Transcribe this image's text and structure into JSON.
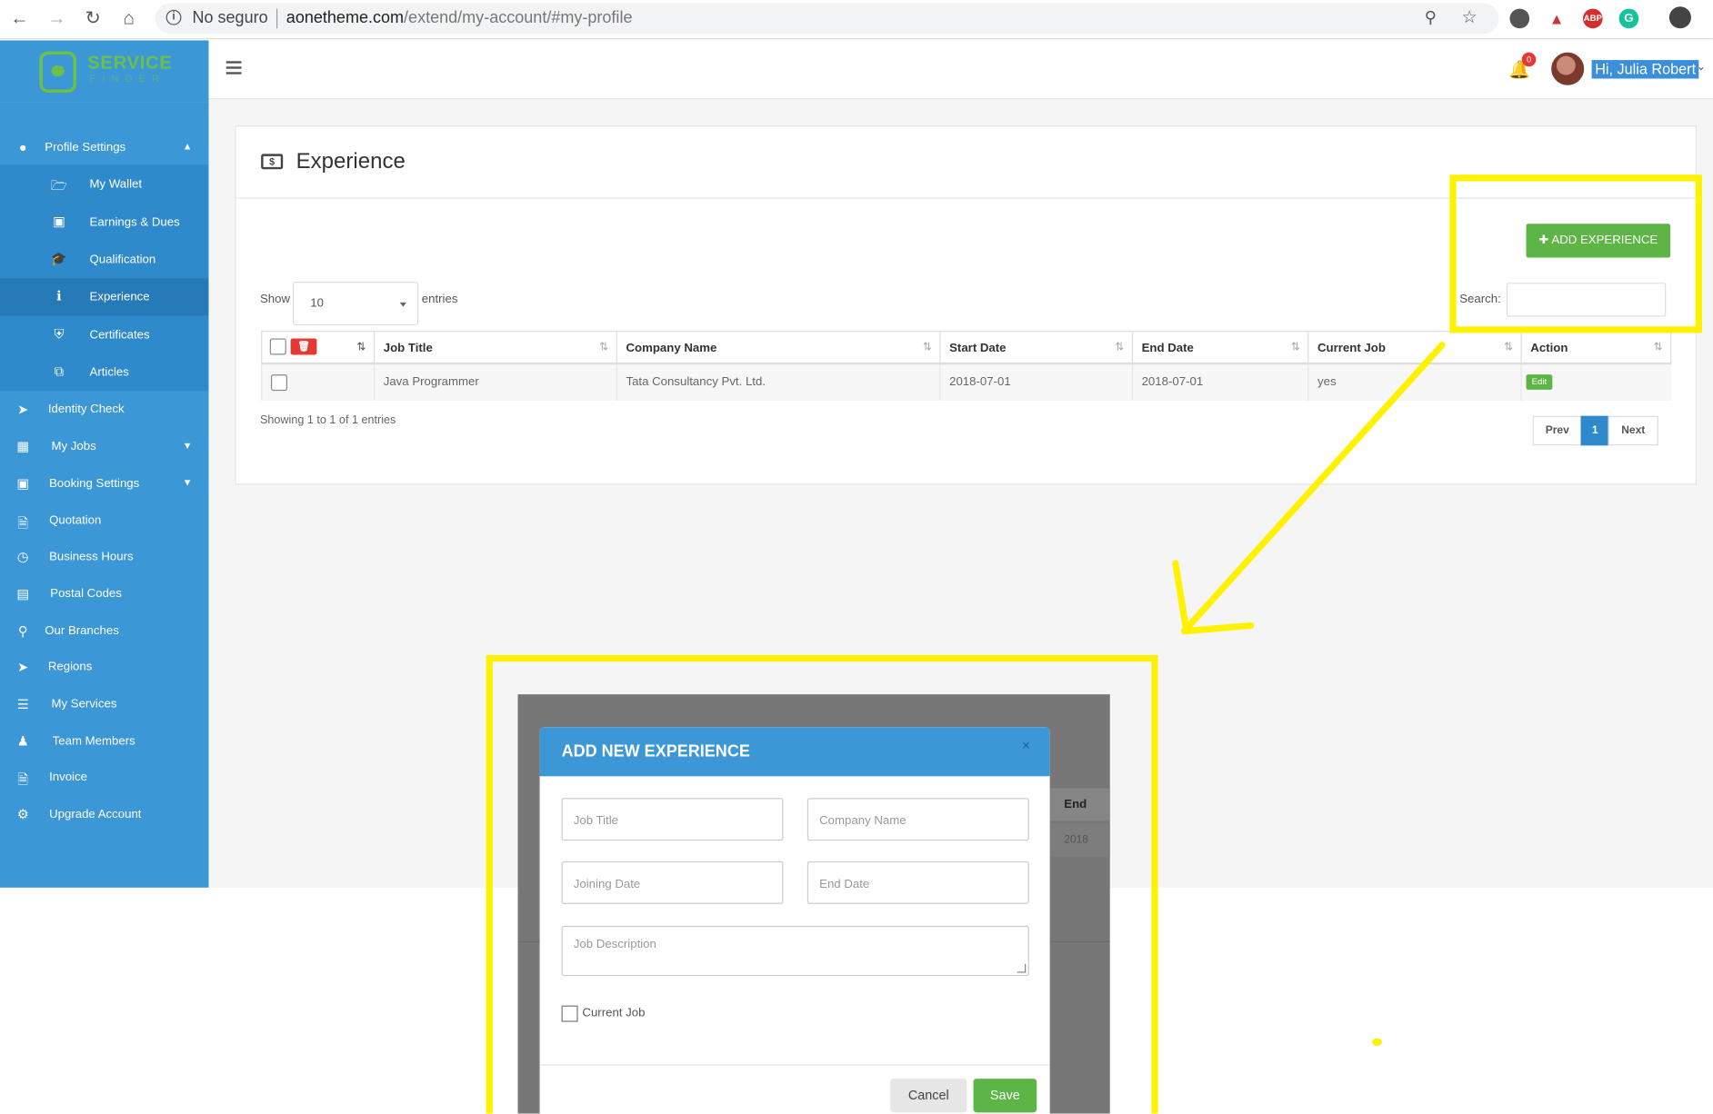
{
  "browser": {
    "insecure_label": "No seguro",
    "url_host": "aonetheme.com",
    "url_path": "/extend/my-account/#my-profile",
    "ext_abp": "ABP"
  },
  "brand": {
    "name": "SERVICE",
    "subname": "FINDER"
  },
  "header": {
    "greeting": "Hi, Julia Robert",
    "notification_count": "0"
  },
  "sidebar": {
    "profile_settings": "Profile Settings",
    "sub_items": [
      {
        "label": "My Wallet",
        "icon": "folder-open-icon"
      },
      {
        "label": "Earnings & Dues",
        "icon": "money-icon"
      },
      {
        "label": "Qualification",
        "icon": "graduation-cap-icon"
      },
      {
        "label": "Experience",
        "icon": "info-icon"
      },
      {
        "label": "Certificates",
        "icon": "shield-icon"
      },
      {
        "label": "Articles",
        "icon": "copy-icon"
      }
    ],
    "items": [
      {
        "label": "Identity Check",
        "icon": "location-arrow-icon"
      },
      {
        "label": "My Jobs",
        "icon": "briefcase-icon"
      },
      {
        "label": "Booking Settings",
        "icon": "money-icon"
      },
      {
        "label": "Quotation",
        "icon": "file-icon"
      },
      {
        "label": "Business Hours",
        "icon": "clock-icon"
      },
      {
        "label": "Postal Codes",
        "icon": "book-icon"
      },
      {
        "label": "Our Branches",
        "icon": "map-marker-icon"
      },
      {
        "label": "Regions",
        "icon": "location-arrow-icon"
      },
      {
        "label": "My Services",
        "icon": "list-icon"
      },
      {
        "label": "Team Members",
        "icon": "users-icon"
      },
      {
        "label": "Invoice",
        "icon": "file-icon"
      },
      {
        "label": "Upgrade Account",
        "icon": "gear-icon"
      }
    ]
  },
  "main": {
    "title": "Experience",
    "add_button": "ADD EXPERIENCE",
    "show_label": "Show",
    "page_length": "10",
    "entries_label": "entries",
    "search_label": "Search:",
    "columns": [
      "Job Title",
      "Company Name",
      "Start Date",
      "End Date",
      "Current Job",
      "Action"
    ],
    "rows": [
      {
        "job_title": "Java Programmer",
        "company": "Tata Consultancy Pvt. Ltd.",
        "start": "2018-07-01",
        "end": "2018-07-01",
        "current": "yes",
        "action": "Edit"
      }
    ],
    "info": "Showing 1 to 1 of 1 entries",
    "pagination": {
      "prev": "Prev",
      "page": "1",
      "next": "Next"
    }
  },
  "modal": {
    "title": "ADD NEW EXPERIENCE",
    "close": "×",
    "job_title_placeholder": "Job Title",
    "company_placeholder": "Company Name",
    "joining_placeholder": "Joining Date",
    "end_placeholder": "End Date",
    "description_placeholder": "Job Description",
    "current_job_label": "Current Job",
    "cancel": "Cancel",
    "save": "Save",
    "bg_column_header": "End",
    "bg_cell": "2018"
  },
  "colors": {
    "sidebar": "#3b97d6",
    "accent_green": "#5cb545",
    "highlight": "#fff200",
    "danger": "#e53935"
  }
}
